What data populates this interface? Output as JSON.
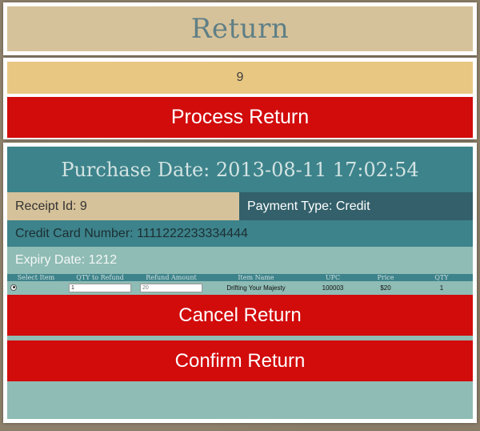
{
  "header": {
    "title": "Return"
  },
  "lookup": {
    "receipt_value": "9",
    "process_label": "Process Return"
  },
  "details": {
    "purchase_date": "Purchase Date: 2013-08-11 17:02:54",
    "receipt_id": "Receipt Id: 9",
    "payment_type": "Payment Type: Credit",
    "cc_number": "Credit Card Number: 1111222233334444",
    "expiry": "Expiry Date: 1212"
  },
  "items_table": {
    "columns": [
      "Select Item",
      "QTY to Refund",
      "Refund Amount",
      "Item Name",
      "UPC",
      "Price",
      "QTY"
    ],
    "rows": [
      {
        "selected": true,
        "qty_to_refund": "1",
        "refund_amount_placeholder": "20",
        "item_name": "Drifting Your Majesty",
        "upc": "100003",
        "price": "$20",
        "qty": "1"
      }
    ]
  },
  "actions": {
    "cancel_label": "Cancel Return",
    "confirm_label": "Confirm Return"
  },
  "colors": {
    "accent_red": "#d20b0b",
    "teal_dark": "#3d838b",
    "teal_light": "#8fbcb4",
    "tan": "#d6c29a",
    "gold": "#e8c783"
  }
}
